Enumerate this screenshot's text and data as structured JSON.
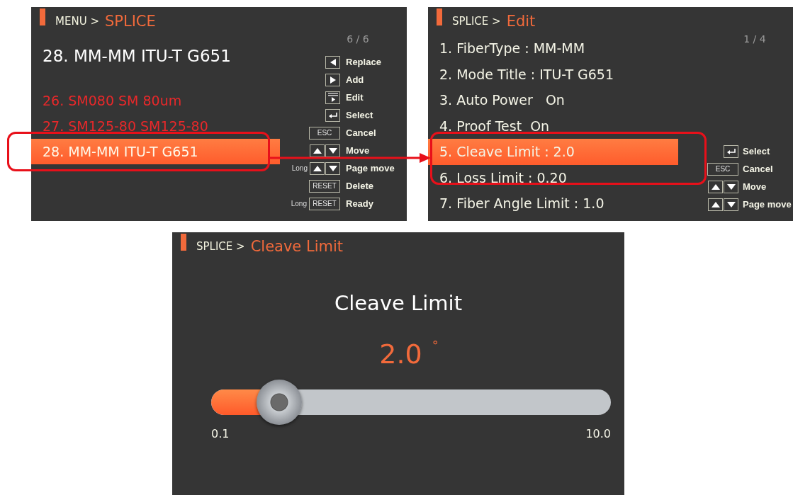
{
  "panels": [
    {
      "kind": "list",
      "breadcrumb": {
        "parent": "MENU >",
        "current": "SPLICE"
      },
      "page": "6 / 6",
      "title": "28. MM-MM ITU-T G651",
      "items": [
        {
          "label": "26. SM080 SM 80um",
          "selected": false
        },
        {
          "label": "27. SM125-80 SM125-80",
          "selected": false
        },
        {
          "label": "28. MM-MM ITU-T G651",
          "selected": true
        }
      ],
      "keys": [
        {
          "keys": [
            {
              "kind": "left"
            }
          ],
          "label": "Replace"
        },
        {
          "keys": [
            {
              "kind": "right"
            }
          ],
          "label": "Add"
        },
        {
          "keys": [
            {
              "kind": "edit"
            }
          ],
          "label": "Edit"
        },
        {
          "keys": [
            {
              "kind": "enter"
            }
          ],
          "label": "Select"
        },
        {
          "keys": [
            {
              "kind": "text",
              "text": "ESC"
            }
          ],
          "label": "Cancel"
        },
        {
          "keys": [
            {
              "kind": "up"
            },
            {
              "kind": "down"
            }
          ],
          "label": "Move"
        },
        {
          "prefix": "Long",
          "keys": [
            {
              "kind": "up"
            },
            {
              "kind": "down"
            }
          ],
          "label": "Page move"
        },
        {
          "keys": [
            {
              "kind": "text",
              "text": "RESET"
            }
          ],
          "label": "Delete"
        },
        {
          "prefix": "Long",
          "keys": [
            {
              "kind": "text",
              "text": "RESET"
            }
          ],
          "label": "Ready"
        }
      ]
    },
    {
      "kind": "menu",
      "breadcrumb": {
        "parent": "SPLICE >",
        "current": "Edit"
      },
      "page": "1 / 4",
      "items": [
        {
          "label": "1. FiberType : MM-MM",
          "selected": false
        },
        {
          "label": "2. Mode Title : ITU-T G651",
          "selected": false
        },
        {
          "label": "3. Auto Power   On",
          "selected": false
        },
        {
          "label": "4. Proof Test  On",
          "selected": false
        },
        {
          "label": "5. Cleave Limit : 2.0",
          "selected": true
        },
        {
          "label": "6. Loss Limit : 0.20",
          "selected": false
        },
        {
          "label": "7. Fiber Angle Limit : 1.0",
          "selected": false
        }
      ],
      "keys": [
        {
          "keys": [
            {
              "kind": "enter"
            }
          ],
          "label": "Select"
        },
        {
          "keys": [
            {
              "kind": "text",
              "text": "ESC"
            }
          ],
          "label": "Cancel"
        },
        {
          "keys": [
            {
              "kind": "up"
            },
            {
              "kind": "down"
            }
          ],
          "label": "Move"
        },
        {
          "keys": [
            {
              "kind": "up"
            },
            {
              "kind": "down"
            }
          ],
          "label": "Page move"
        }
      ]
    },
    {
      "kind": "slider",
      "breadcrumb": {
        "parent": "SPLICE >",
        "current": "Cleave Limit"
      },
      "heading": "Cleave Limit",
      "value": "2.0",
      "unit": "°",
      "level": 0.17,
      "min": "0.1",
      "max": "10.0"
    }
  ]
}
